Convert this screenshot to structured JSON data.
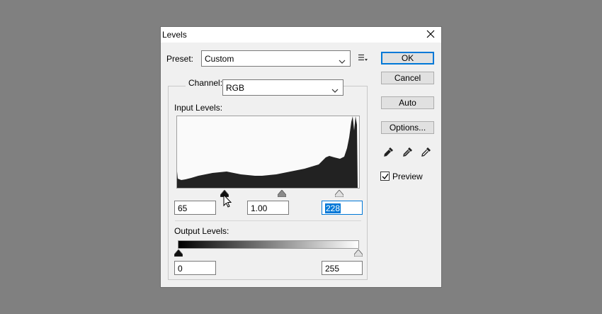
{
  "dialog": {
    "title": "Levels",
    "close_icon": "close-icon"
  },
  "preset": {
    "label": "Preset:",
    "value": "Custom",
    "menu_icon": "preset-options-icon"
  },
  "channel": {
    "label": "Channel:",
    "value": "RGB"
  },
  "input_levels": {
    "label": "Input Levels:",
    "black": "65",
    "mid": "1.00",
    "white": "228",
    "black_value": 65,
    "white_value": 228
  },
  "output_levels": {
    "label": "Output Levels:",
    "black": "0",
    "white": "255"
  },
  "buttons": {
    "ok": "OK",
    "cancel": "Cancel",
    "auto": "Auto",
    "options": "Options..."
  },
  "eyedroppers": [
    "black-eyedropper-icon",
    "gray-eyedropper-icon",
    "white-eyedropper-icon"
  ],
  "preview": {
    "label": "Preview",
    "checked": true
  },
  "colors": {
    "accent": "#0078d7",
    "background": "#808080",
    "dialog": "#f0f0f0"
  }
}
